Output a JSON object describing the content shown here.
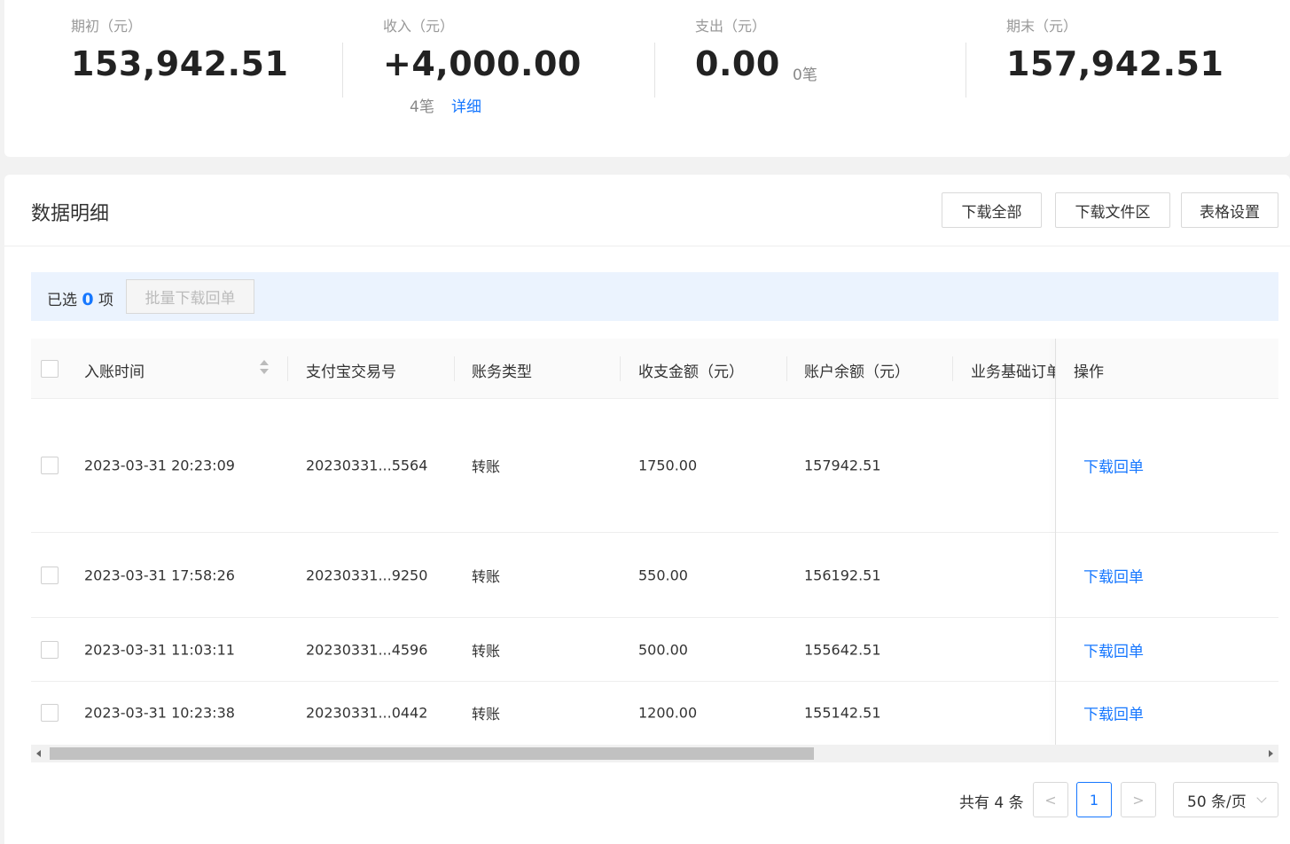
{
  "summary": {
    "opening": {
      "label": "期初（元）",
      "value": "153,942.51"
    },
    "income": {
      "label": "收入（元）",
      "value": "+4,000.00",
      "count": "4笔",
      "detail_link": "详细"
    },
    "expense": {
      "label": "支出（元）",
      "value": "0.00",
      "count": "0笔"
    },
    "closing": {
      "label": "期末（元）",
      "value": "157,942.51"
    }
  },
  "detail": {
    "title": "数据明细",
    "buttons": {
      "download_all": "下载全部",
      "download_files": "下载文件区",
      "table_settings": "表格设置"
    },
    "selection": {
      "prefix": "已选",
      "count": "0",
      "suffix": "项",
      "batch_button": "批量下载回单"
    }
  },
  "table": {
    "columns": [
      "入账时间",
      "支付宝交易号",
      "账务类型",
      "收支金额（元）",
      "账户余额（元）",
      "业务基础订单号",
      "操作"
    ],
    "rows": [
      {
        "time": "2023-03-31 20:23:09",
        "trade_no": "20230331...5564",
        "type": "转账",
        "amount": "1750.00",
        "balance": "157942.51",
        "action": "下载回单"
      },
      {
        "time": "2023-03-31 17:58:26",
        "trade_no": "20230331...9250",
        "type": "转账",
        "amount": "550.00",
        "balance": "156192.51",
        "action": "下载回单"
      },
      {
        "time": "2023-03-31 11:03:11",
        "trade_no": "20230331...4596",
        "type": "转账",
        "amount": "500.00",
        "balance": "155642.51",
        "action": "下载回单"
      },
      {
        "time": "2023-03-31 10:23:38",
        "trade_no": "20230331...0442",
        "type": "转账",
        "amount": "1200.00",
        "balance": "155142.51",
        "action": "下载回单"
      }
    ]
  },
  "pagination": {
    "total_text": "共有 4 条",
    "prev_icon": "chevron-left-icon",
    "next_icon": "chevron-right-icon",
    "prev": "<",
    "next": ">",
    "current_page": "1",
    "page_size": "50 条/页"
  },
  "colors": {
    "accent": "#1677ff",
    "selbar_bg": "#ebf3fe"
  }
}
